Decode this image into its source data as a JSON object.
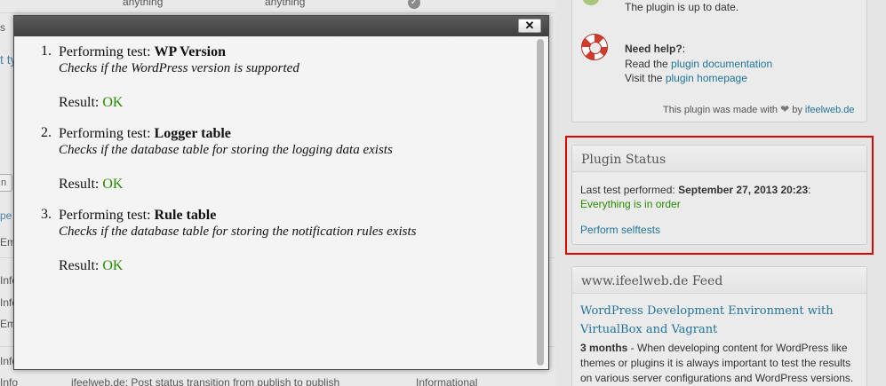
{
  "background": {
    "row0": {
      "c1": "anything",
      "c2": "anything"
    },
    "left_fragments": {
      "s": "s",
      "t_type": "t ty",
      "n": "n",
      "pe": "pe",
      "em1": "Em",
      "info1": "Info",
      "info2": "Info",
      "em2": "Em",
      "info3": "Info",
      "info4": "Info"
    },
    "bottom_row": {
      "message": "ifeelweb.de: Post status transition from publish to publish",
      "level": "Informational"
    }
  },
  "sidebar": {
    "up_to_date": "The plugin is up to date.",
    "need_help_label": "Need help?",
    "need_help_colon": ":",
    "read_the": "Read the",
    "plugin_documentation": "plugin documentation",
    "visit_the": "Visit the",
    "plugin_homepage": "plugin homepage",
    "made_with_prefix": "This plugin was made with",
    "made_with_by": "by",
    "made_with_link": "ifeelweb.de",
    "plugin_status": {
      "title": "Plugin Status",
      "last_test_label": "Last test performed:",
      "last_test_date": "September 27, 2013 20:23",
      "last_test_colon": ":",
      "status_text": "Everything is in order",
      "selftest_link": "Perform selftests"
    },
    "feed": {
      "title": "www.ifeelweb.de Feed",
      "post_title_line1": "WordPress Development Environment with",
      "post_title_line2": "VirtualBox and Vagrant",
      "age": "3 months",
      "excerpt_line1": " - When developing content for WordPress like",
      "excerpt_line2": "themes or plugins it is always important to test the results",
      "excerpt_line3": "on various server configurations and WordPress versions."
    }
  },
  "modal": {
    "close_label": "✕",
    "tests": [
      {
        "num": "1.",
        "prefix": "Performing test: ",
        "name": "WP Version",
        "description": "Checks if the WordPress version is supported",
        "result_label": "Result: ",
        "result": "OK"
      },
      {
        "num": "2.",
        "prefix": "Performing test: ",
        "name": "Logger table",
        "description": "Checks if the database table for storing the logging data exists",
        "result_label": "Result: ",
        "result": "OK"
      },
      {
        "num": "3.",
        "prefix": "Performing test: ",
        "name": "Rule table",
        "description": "Checks if the database table for storing the notification rules exists",
        "result_label": "Result: ",
        "result": "OK"
      }
    ]
  },
  "colors": {
    "highlight": "#e10000",
    "ok_green": "#2a8a00",
    "link_blue": "#21759b"
  }
}
